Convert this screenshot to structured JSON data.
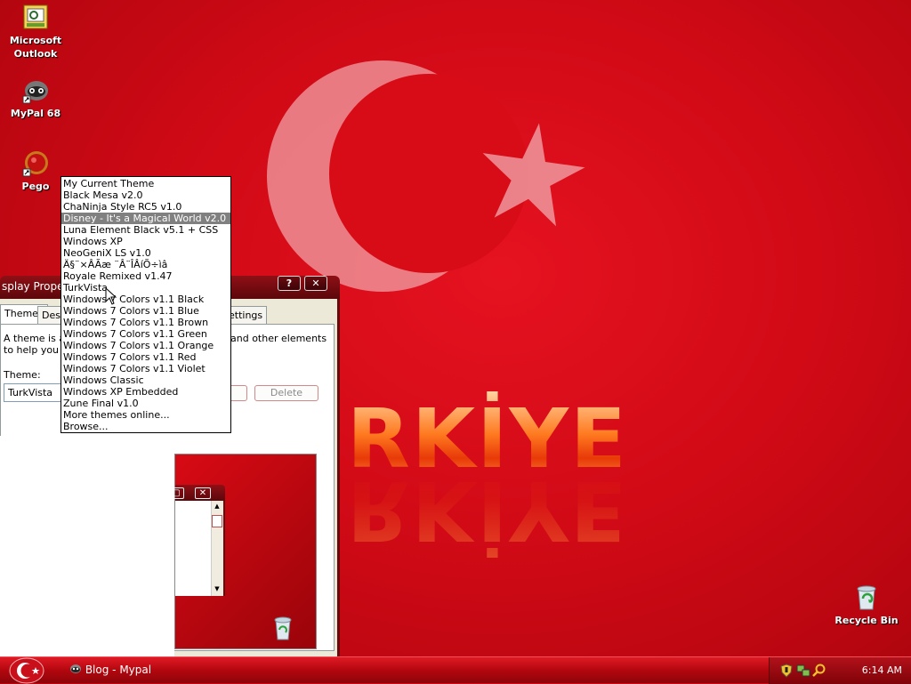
{
  "desktop": {
    "icons": [
      {
        "label_line1": "Microsoft",
        "label_line2": "Outlook"
      },
      {
        "label_line1": "MyPal 68",
        "label_line2": ""
      },
      {
        "label_line1": "Pego",
        "label_line2": ""
      },
      {
        "label_line1": "Recycle Bin",
        "label_line2": ""
      }
    ],
    "wallpaper_text": "RKİYE"
  },
  "dialog": {
    "title": "splay Propert",
    "help_label": "?",
    "close_label": "✕",
    "tabs": [
      "Themes",
      "Desk",
      "ettings"
    ],
    "description_line1": "A theme is a b",
    "description_line1_right": "and other elements",
    "description_line2": "to help you pe",
    "theme_label": "Theme:",
    "theme_value": "TurkVista",
    "delete_label": "Delete"
  },
  "theme_dropdown": {
    "selected_index": 3,
    "options": [
      "My Current Theme",
      "Black Mesa v2.0",
      "ChaNinja Style RC5 v1.0",
      "Disney - It's a Magical World v2.0",
      "Luna Element Black v5.1 + CSS",
      "Windows XP",
      "NeoGeniX LS v1.0",
      "Ä§¨×ÂÃæ ¨Â¨ÎÂíÕ÷ìâ",
      "Royale Remixed v1.47",
      "TurkVista",
      "Windows 7 Colors v1.1 Black",
      "Windows 7 Colors v1.1 Blue",
      "Windows 7 Colors v1.1 Brown",
      "Windows 7 Colors v1.1 Green",
      "Windows 7 Colors v1.1 Orange",
      "Windows 7 Colors v1.1 Red",
      "Windows 7 Colors v1.1 Violet",
      "Windows Classic",
      "Windows XP Embedded",
      "Zune Final v1.0",
      "More themes online...",
      "Browse..."
    ]
  },
  "taskbar": {
    "task_label": "Blog - Mypal",
    "clock": "6:14 AM"
  },
  "colors": {
    "wallpaper_red": "#d10a16",
    "title_bar": "#8e1016",
    "selection": "#808080"
  }
}
